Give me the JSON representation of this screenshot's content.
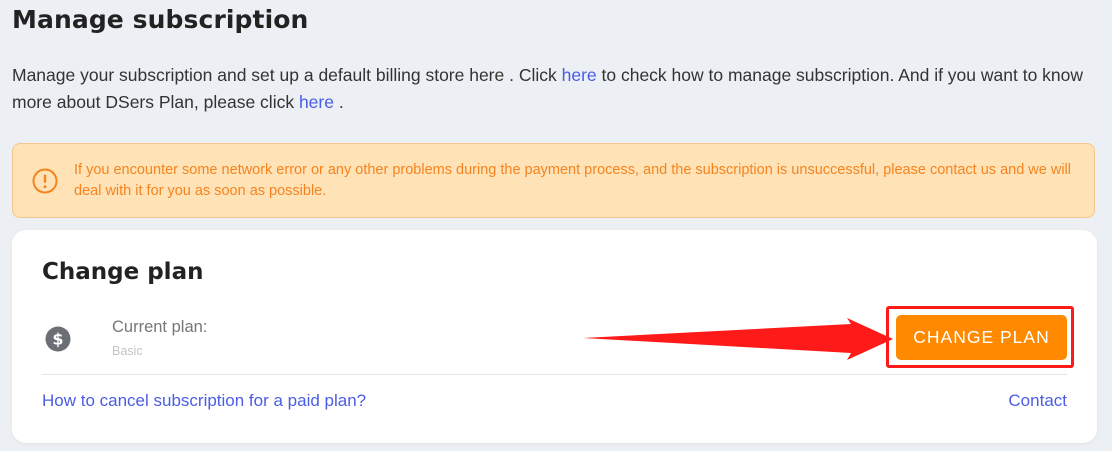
{
  "page": {
    "title": "Manage subscription",
    "intro": {
      "part1": "Manage your subscription and set up a default billing store here . Click ",
      "link1": "here",
      "part2": " to check how to manage subscription. And if you want to know more about DSers Plan, please click ",
      "link2": "here",
      "part3": " ."
    }
  },
  "alert": {
    "icon": "exclamation-circle-icon",
    "text": "If you encounter some network error or any other problems during the payment process, and the subscription is unsuccessful, please contact us and we will deal with it for you as soon as possible."
  },
  "plan_card": {
    "title": "Change plan",
    "icon": "dollar-circle-icon",
    "current_plan_label": "Current plan:",
    "current_plan_value": "Basic",
    "change_button": "CHANGE PLAN",
    "cancel_link": "How to cancel subscription for a paid plan?",
    "contact_link": "Contact"
  },
  "colors": {
    "accent_orange": "#ff8a00",
    "link_blue": "#4b5de4",
    "alert_bg": "#ffe2b6",
    "alert_text": "#f5841f",
    "annotation_red": "#ff1a1a"
  }
}
